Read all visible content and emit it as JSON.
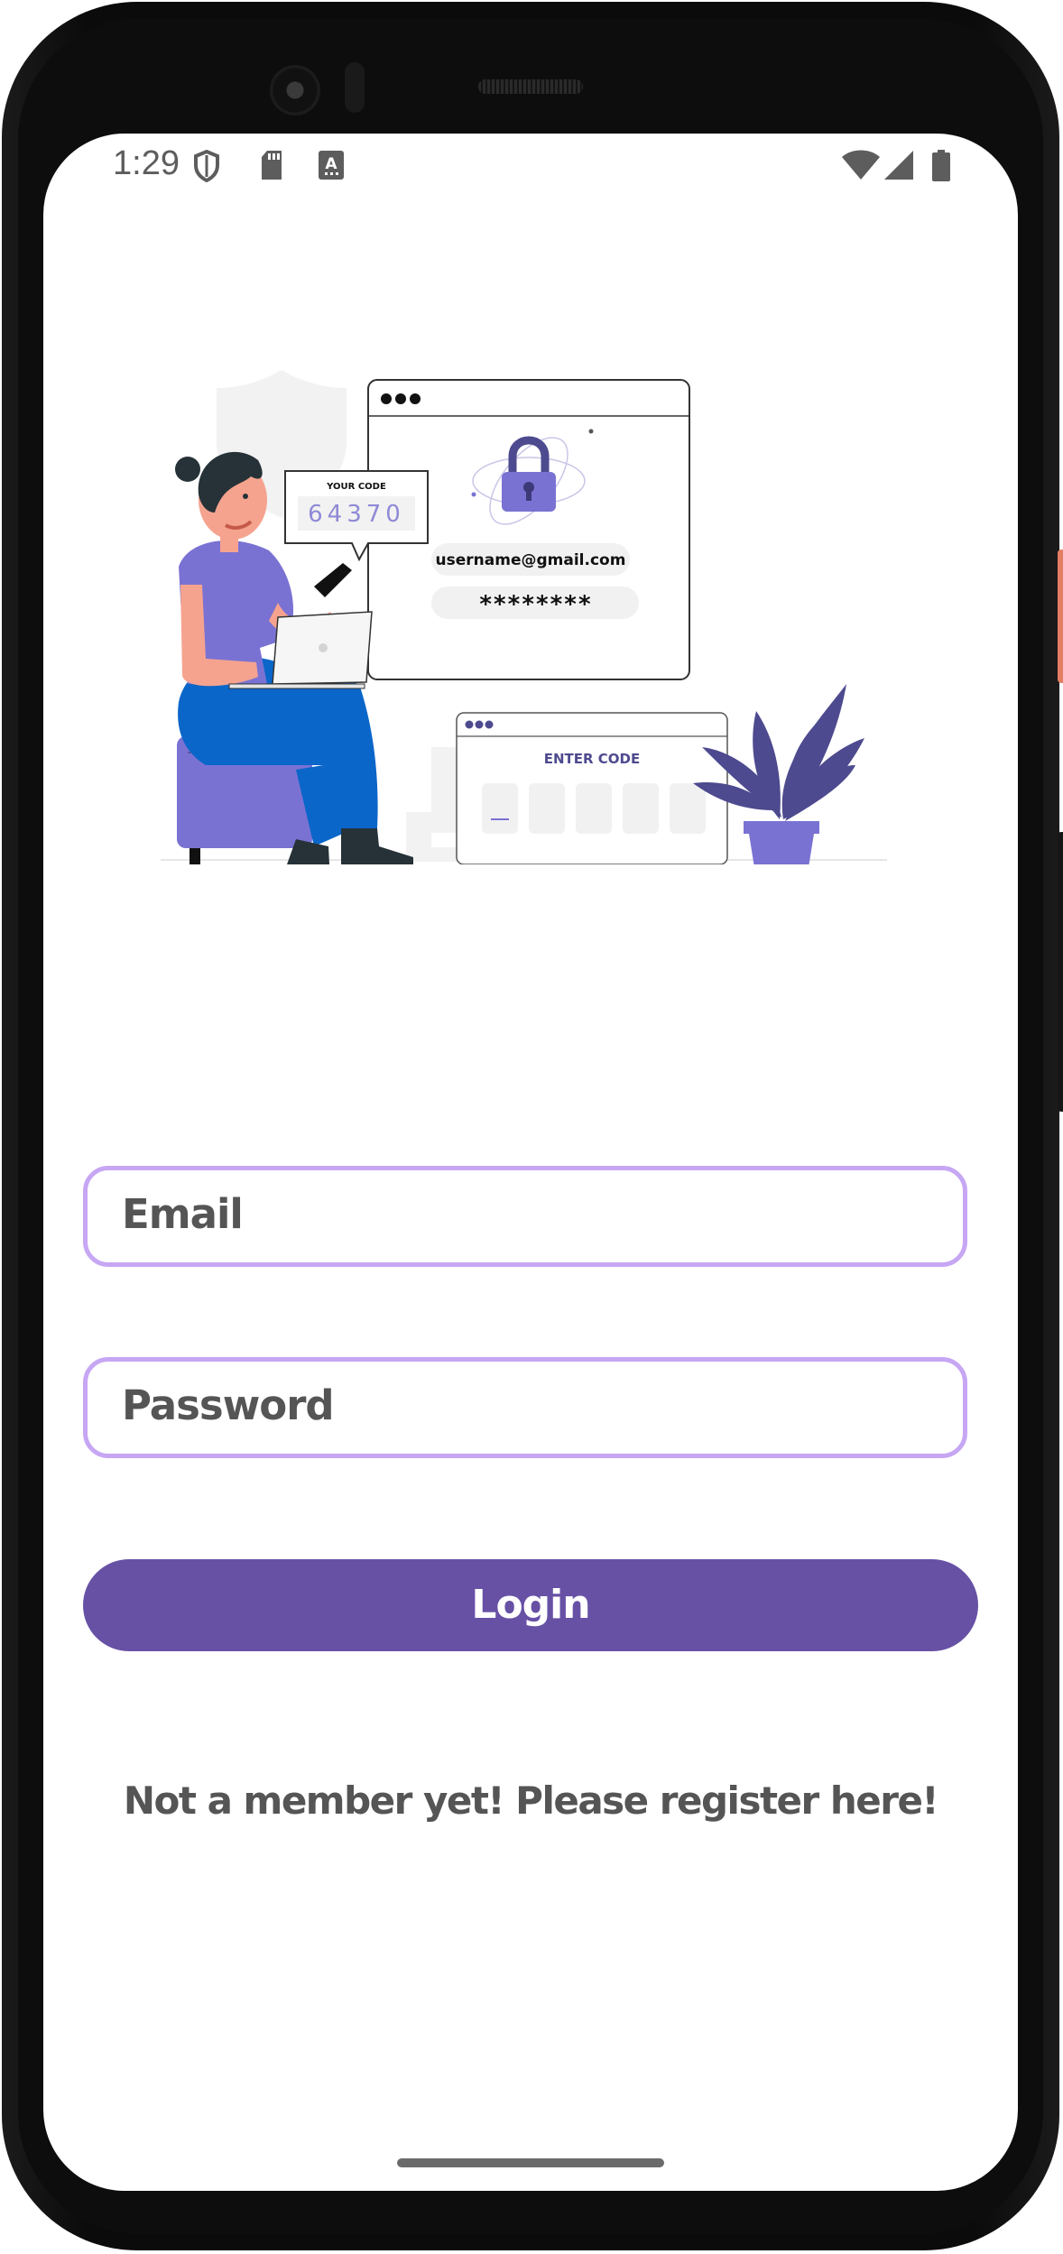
{
  "status_bar": {
    "time": "1:29",
    "icons": [
      "shield-icon",
      "sd-card-icon",
      "keyboard-a-icon",
      "wifi-icon",
      "cell-signal-icon",
      "battery-icon"
    ]
  },
  "illustration": {
    "code_label": "YOUR CODE",
    "code_value": "64370",
    "username": "username@gmail.com",
    "password_mask": "********",
    "enter_code_label": "ENTER CODE"
  },
  "form": {
    "email_placeholder": "Email",
    "password_placeholder": "Password",
    "login_label": "Login",
    "register_text": "Not a member yet! Please register here!"
  },
  "colors": {
    "accent": "#6751a5",
    "field_border": "#c7a6f4",
    "text_gray": "#555555",
    "illustration_purple": "#7a72d3",
    "illustration_blue": "#0b66c9"
  }
}
